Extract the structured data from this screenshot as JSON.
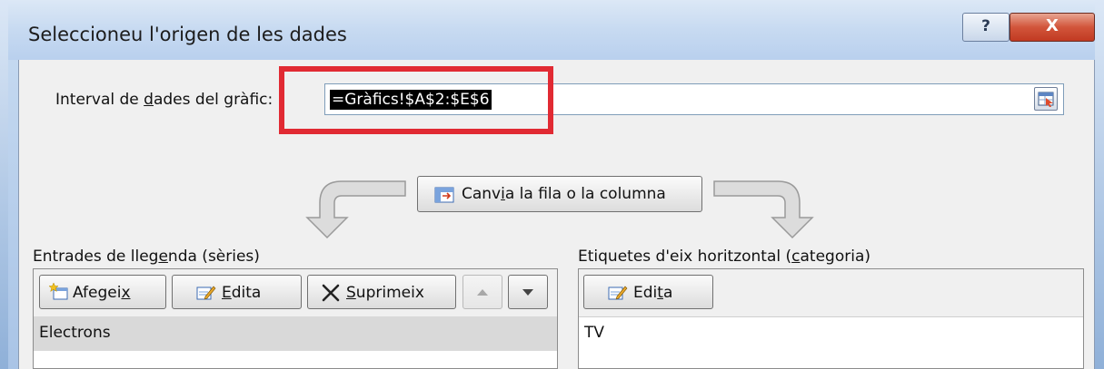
{
  "window": {
    "title": "Seleccioneu l'origen de les dades",
    "help_label": "?",
    "close_label": "X"
  },
  "range": {
    "label_pre": "Interval de ",
    "label_u": "d",
    "label_post": "ades del gràfic:",
    "value": "=Gràfics!$A$2:$E$6"
  },
  "switch": {
    "label_pre": "Canv",
    "label_u": "i",
    "label_post": "a la fila o la columna"
  },
  "legend": {
    "label_pre": "Entrades de lleg",
    "label_u": "e",
    "label_post": "nda (sèries)",
    "add_pre": "Afegei",
    "add_u": "x",
    "edit_u": "E",
    "edit_post": "dita",
    "remove_u": "S",
    "remove_post": "uprimeix",
    "items": [
      "Electrons"
    ]
  },
  "categories": {
    "label_pre": "Etiquetes d'eix horitzontal (",
    "label_u": "c",
    "label_post": "ategoria)",
    "edit_pre": "Edi",
    "edit_u": "t",
    "edit_post": "a",
    "items": [
      "TV"
    ]
  },
  "colors": {
    "highlight": "#e12a33",
    "close_button": "#c13a22"
  }
}
